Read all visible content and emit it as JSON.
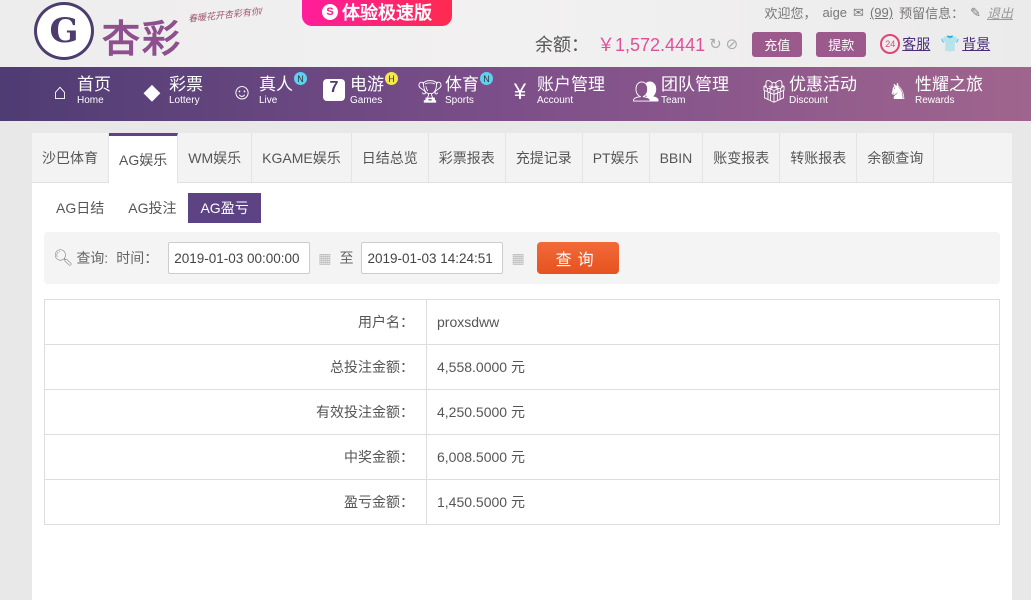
{
  "header": {
    "logo_text": "杏彩",
    "slogan": "春暖花开杏彩有你/",
    "fast_label": "体验极速版",
    "welcome": "欢迎您，",
    "username": "aige",
    "mail_count": "(99)",
    "reserved_info": "预留信息：",
    "logout": "退出",
    "balance_label": "余额：",
    "balance": "￥1,572.4441",
    "deposit": "充值",
    "withdraw": "提款",
    "service": "客服",
    "background": "背景"
  },
  "nav": [
    {
      "zh": "首页",
      "en": "Home"
    },
    {
      "zh": "彩票",
      "en": "Lottery"
    },
    {
      "zh": "真人",
      "en": "Live",
      "badge": "N"
    },
    {
      "zh": "电游",
      "en": "Games",
      "badge": "H"
    },
    {
      "zh": "体育",
      "en": "Sports",
      "badge": "N"
    },
    {
      "zh": "账户管理",
      "en": "Account"
    },
    {
      "zh": "团队管理",
      "en": "Team"
    },
    {
      "zh": "优惠活动",
      "en": "Discount"
    },
    {
      "zh": "性耀之旅",
      "en": "Rewards"
    }
  ],
  "tabs": [
    "沙巴体育",
    "AG娱乐",
    "WM娱乐",
    "KGAME娱乐",
    "日结总览",
    "彩票报表",
    "充提记录",
    "PT娱乐",
    "BBIN",
    "账变报表",
    "转账报表",
    "余额查询"
  ],
  "subtabs": [
    "AG日结",
    "AG投注",
    "AG盈亏"
  ],
  "query": {
    "label": "查询:",
    "time_label": "时间：",
    "start": "2019-01-03 00:00:00",
    "to": "至",
    "end": "2019-01-03 14:24:51",
    "button": "查询"
  },
  "rows": [
    {
      "label": "用户名：",
      "value": "proxsdww"
    },
    {
      "label": "总投注金额：",
      "value": "4,558.0000 元"
    },
    {
      "label": "有效投注金额：",
      "value": "4,250.5000 元"
    },
    {
      "label": "中奖金额：",
      "value": "6,008.5000 元"
    },
    {
      "label": "盈亏金额：",
      "value": "1,450.5000 元"
    }
  ]
}
